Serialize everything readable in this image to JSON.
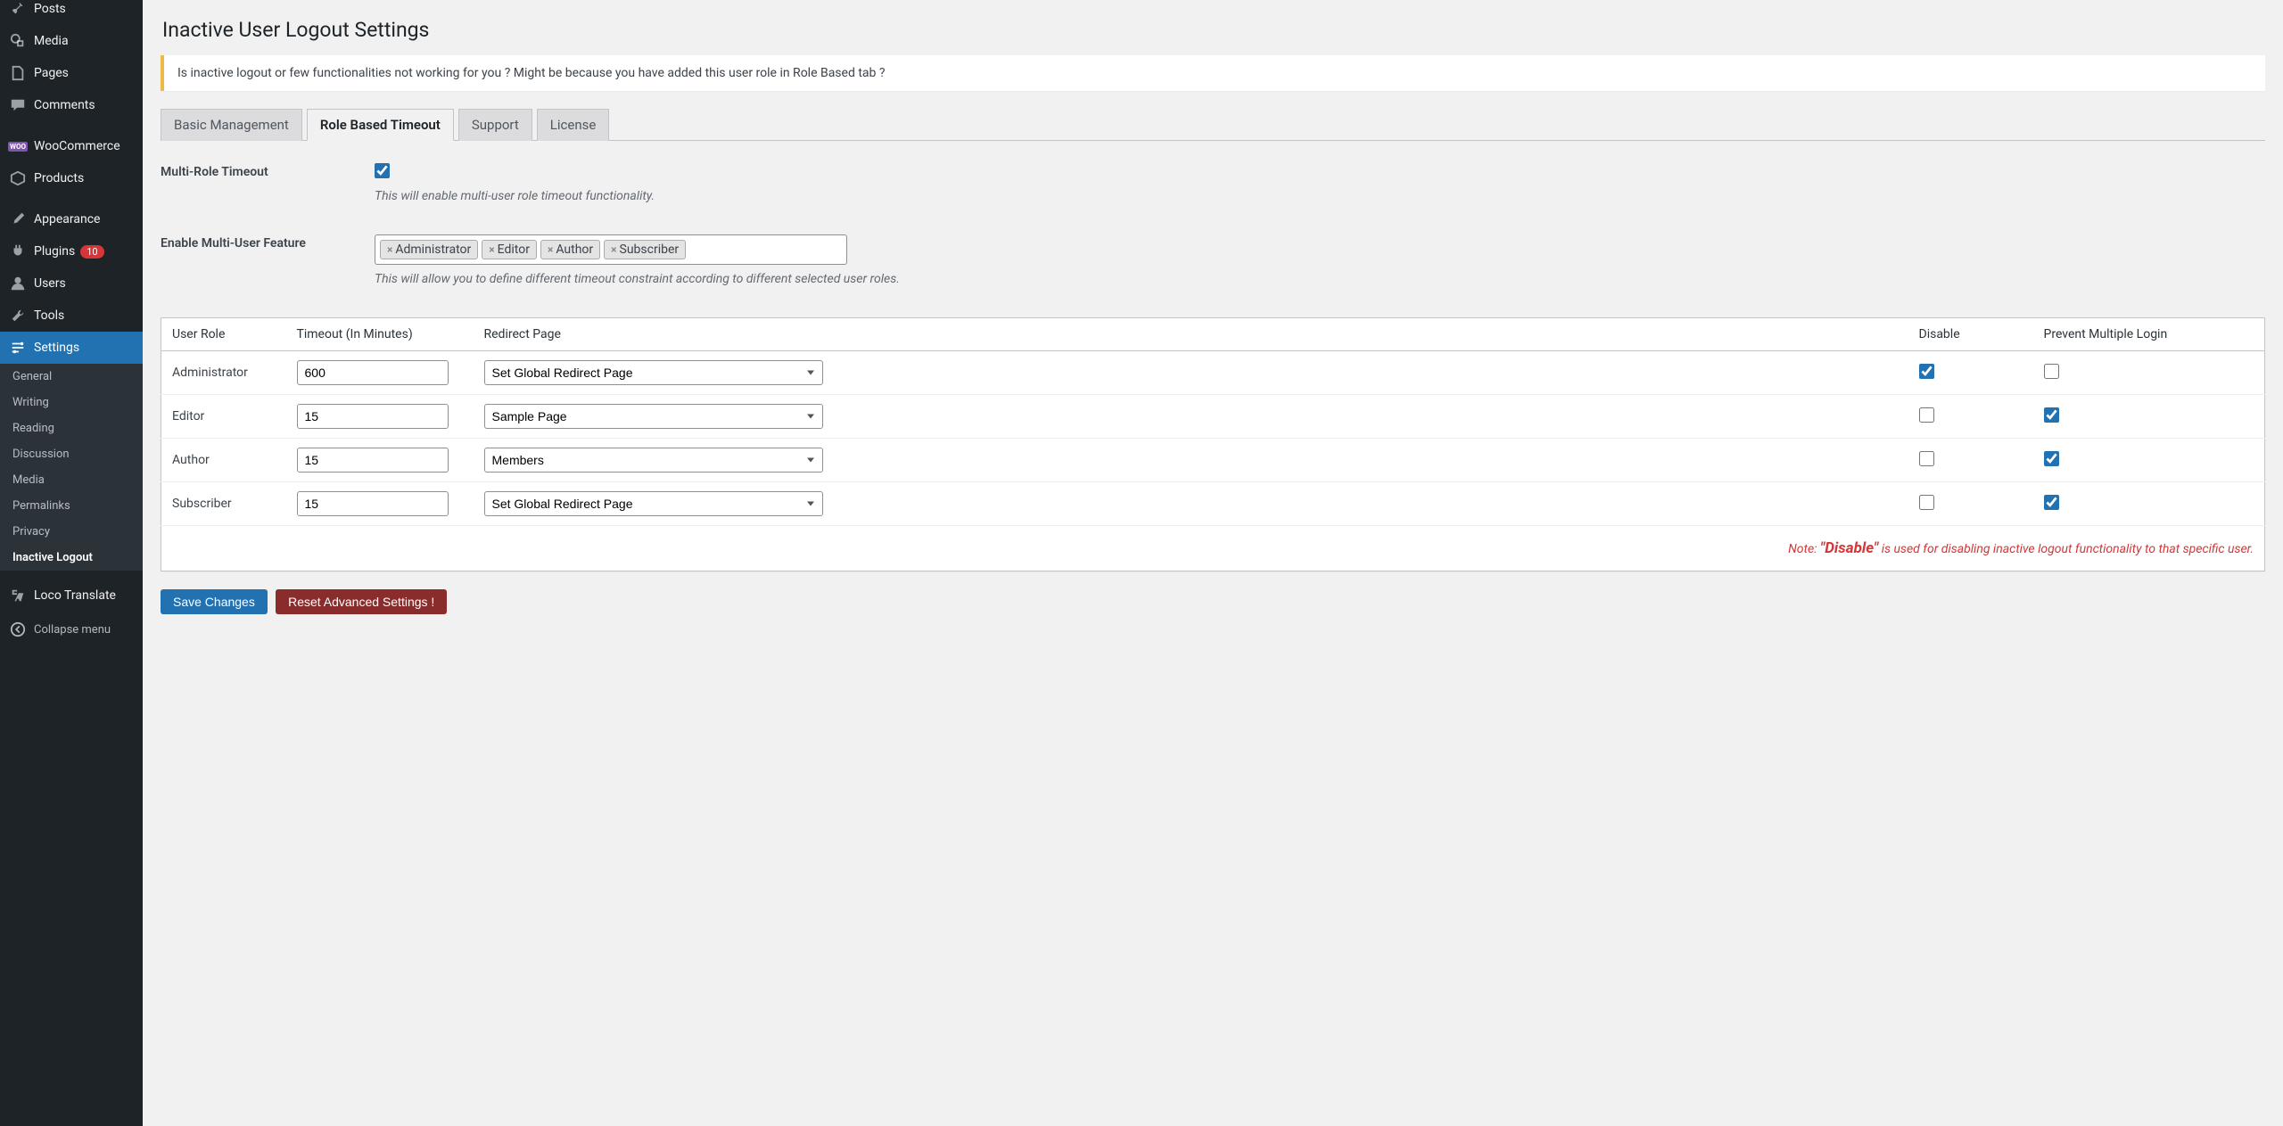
{
  "sidebar": {
    "items": [
      {
        "id": "posts",
        "label": "Posts"
      },
      {
        "id": "media",
        "label": "Media"
      },
      {
        "id": "pages",
        "label": "Pages"
      },
      {
        "id": "comments",
        "label": "Comments"
      },
      {
        "id": "woocommerce",
        "label": "WooCommerce"
      },
      {
        "id": "products",
        "label": "Products"
      },
      {
        "id": "appearance",
        "label": "Appearance"
      },
      {
        "id": "plugins",
        "label": "Plugins",
        "badge": "10"
      },
      {
        "id": "users",
        "label": "Users"
      },
      {
        "id": "tools",
        "label": "Tools"
      },
      {
        "id": "settings",
        "label": "Settings"
      }
    ],
    "submenu": [
      "General",
      "Writing",
      "Reading",
      "Discussion",
      "Media",
      "Permalinks",
      "Privacy",
      "Inactive Logout"
    ],
    "loco": "Loco Translate",
    "collapse": "Collapse menu"
  },
  "page": {
    "title": "Inactive User Logout Settings",
    "notice": "Is inactive logout or few functionalities not working for you ? Might be because you have added this user role in Role Based tab ?",
    "tabs": [
      "Basic Management",
      "Role Based Timeout",
      "Support",
      "License"
    ],
    "multi_role_label": "Multi-Role Timeout",
    "multi_role_desc": "This will enable multi-user role timeout functionality.",
    "enable_label": "Enable Multi-User Feature",
    "enable_tags": [
      "Administrator",
      "Editor",
      "Author",
      "Subscriber"
    ],
    "enable_desc": "This will allow you to define different timeout constraint according to different selected user roles.",
    "table": {
      "headers": [
        "User Role",
        "Timeout (In Minutes)",
        "Redirect Page",
        "Disable",
        "Prevent Multiple Login"
      ],
      "rows": [
        {
          "role": "Administrator",
          "timeout": "600",
          "redirect": "Set Global Redirect Page",
          "disable": true,
          "prevent": false
        },
        {
          "role": "Editor",
          "timeout": "15",
          "redirect": "Sample Page",
          "disable": false,
          "prevent": true
        },
        {
          "role": "Author",
          "timeout": "15",
          "redirect": "Members",
          "disable": false,
          "prevent": true
        },
        {
          "role": "Subscriber",
          "timeout": "15",
          "redirect": "Set Global Redirect Page",
          "disable": false,
          "prevent": true
        }
      ]
    },
    "note_prefix": "Note: ",
    "note_bold": "\"Disable\"",
    "note_suffix": " is used for disabling inactive logout functionality to that specific user.",
    "save_btn": "Save Changes",
    "reset_btn": "Reset Advanced Settings !"
  }
}
